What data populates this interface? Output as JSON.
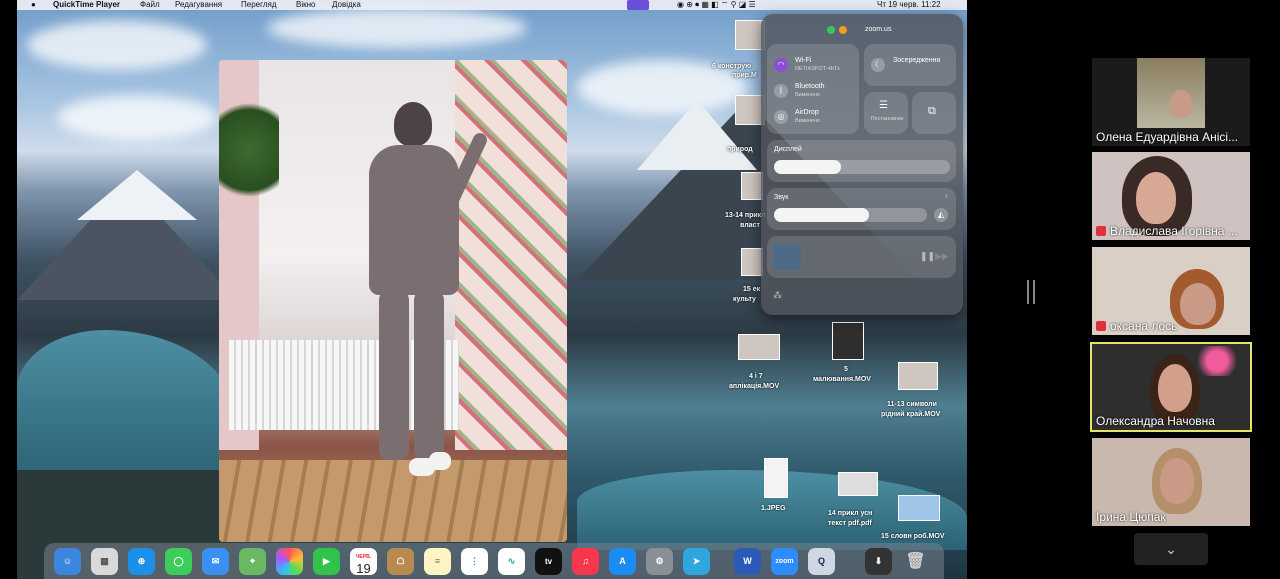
{
  "menubar": {
    "app": "QuickTime Player",
    "menus": [
      "Файл",
      "Редагування",
      "Перегляд",
      "Вікно",
      "Довідка"
    ],
    "clock": "Чт 19 черв.  11:22"
  },
  "control_center": {
    "title": "zoom.us",
    "wifi": {
      "label": "Wi-Fi",
      "value": "NETIASPOT-4bTx"
    },
    "bluetooth": {
      "label": "Bluetooth",
      "value": "Вимкнено"
    },
    "airdrop": {
      "label": "AirDrop",
      "value": "Вимкнено"
    },
    "focus": {
      "label": "Зосередження"
    },
    "stage": {
      "label": "Постановник"
    },
    "display": {
      "label": "Дисплей",
      "level": 0.38
    },
    "sound": {
      "label": "Звук",
      "level": 0.62
    }
  },
  "desktop_files": [
    {
      "label": "6 конструю",
      "sub": "прир.M"
    },
    {
      "label": "природ"
    },
    {
      "label": "13-14 прикл",
      "sub": "власт"
    },
    {
      "label": "15 ек",
      "sub": "культу"
    },
    {
      "label": "4 і 7",
      "sub": "аплікація.MOV"
    },
    {
      "label": "5",
      "sub": "малювання.MOV"
    },
    {
      "label": "11-13 символи",
      "sub": "рідний край.MOV"
    },
    {
      "label": "1.JPEG"
    },
    {
      "label": "14 прикл усн",
      "sub": "текст pdf.pdf"
    },
    {
      "label": "15 словн роб.MOV"
    }
  ],
  "dock": {
    "calendar_month": "ЧЕРВ.",
    "calendar_day": "19",
    "apps": [
      "Finder",
      "Launchpad",
      "Safari",
      "Messages",
      "Mail",
      "Maps",
      "Photos",
      "FaceTime",
      "Calendar",
      "Contacts",
      "Notes",
      "Reminders",
      "Freeform",
      "TV",
      "Music",
      "App Store",
      "System Settings",
      "Telegram",
      "Word",
      "zoom",
      "QuickTime",
      "Downloads",
      "Trash"
    ],
    "tv_label": "tv",
    "zoom_label": "zoom"
  },
  "participants": [
    {
      "name": "Олена Едуардівна Анісі...",
      "muted": false
    },
    {
      "name": "Владислава Ігорівна ...",
      "muted": true
    },
    {
      "name": "оксана лось",
      "muted": true
    },
    {
      "name": "Олександра Начовна",
      "muted": false,
      "active": true
    },
    {
      "name": "Ірина Цюпак",
      "muted": false
    }
  ],
  "colors": {
    "active_border": "#e3e56b",
    "mute": "#e0303a"
  }
}
